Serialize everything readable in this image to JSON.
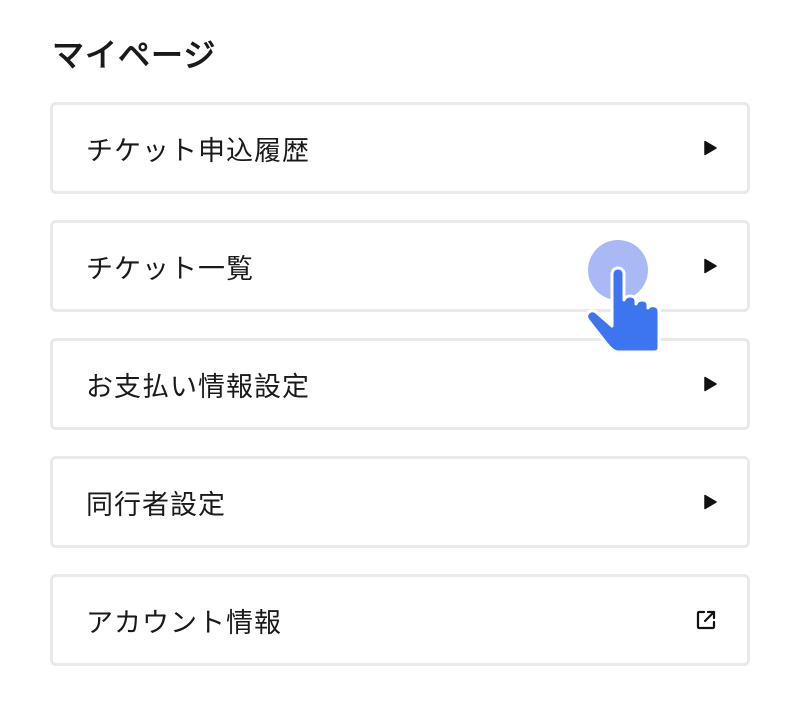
{
  "page": {
    "title": "マイページ"
  },
  "menu": {
    "items": [
      {
        "label": "チケット申込履歴",
        "icon": "play-arrow-icon"
      },
      {
        "label": "チケット一覧",
        "icon": "play-arrow-icon"
      },
      {
        "label": "お支払い情報設定",
        "icon": "play-arrow-icon"
      },
      {
        "label": "同行者設定",
        "icon": "play-arrow-icon"
      },
      {
        "label": "アカウント情報",
        "icon": "external-link-icon"
      }
    ]
  },
  "overlay": {
    "cursor_icon": "tap-hand-cursor-icon",
    "colors": {
      "ripple": "#a8b9f5",
      "hand": "#3d74f0"
    }
  },
  "colors": {
    "border": "#e9e9e9",
    "text": "#1a1a1a",
    "background": "#ffffff"
  }
}
